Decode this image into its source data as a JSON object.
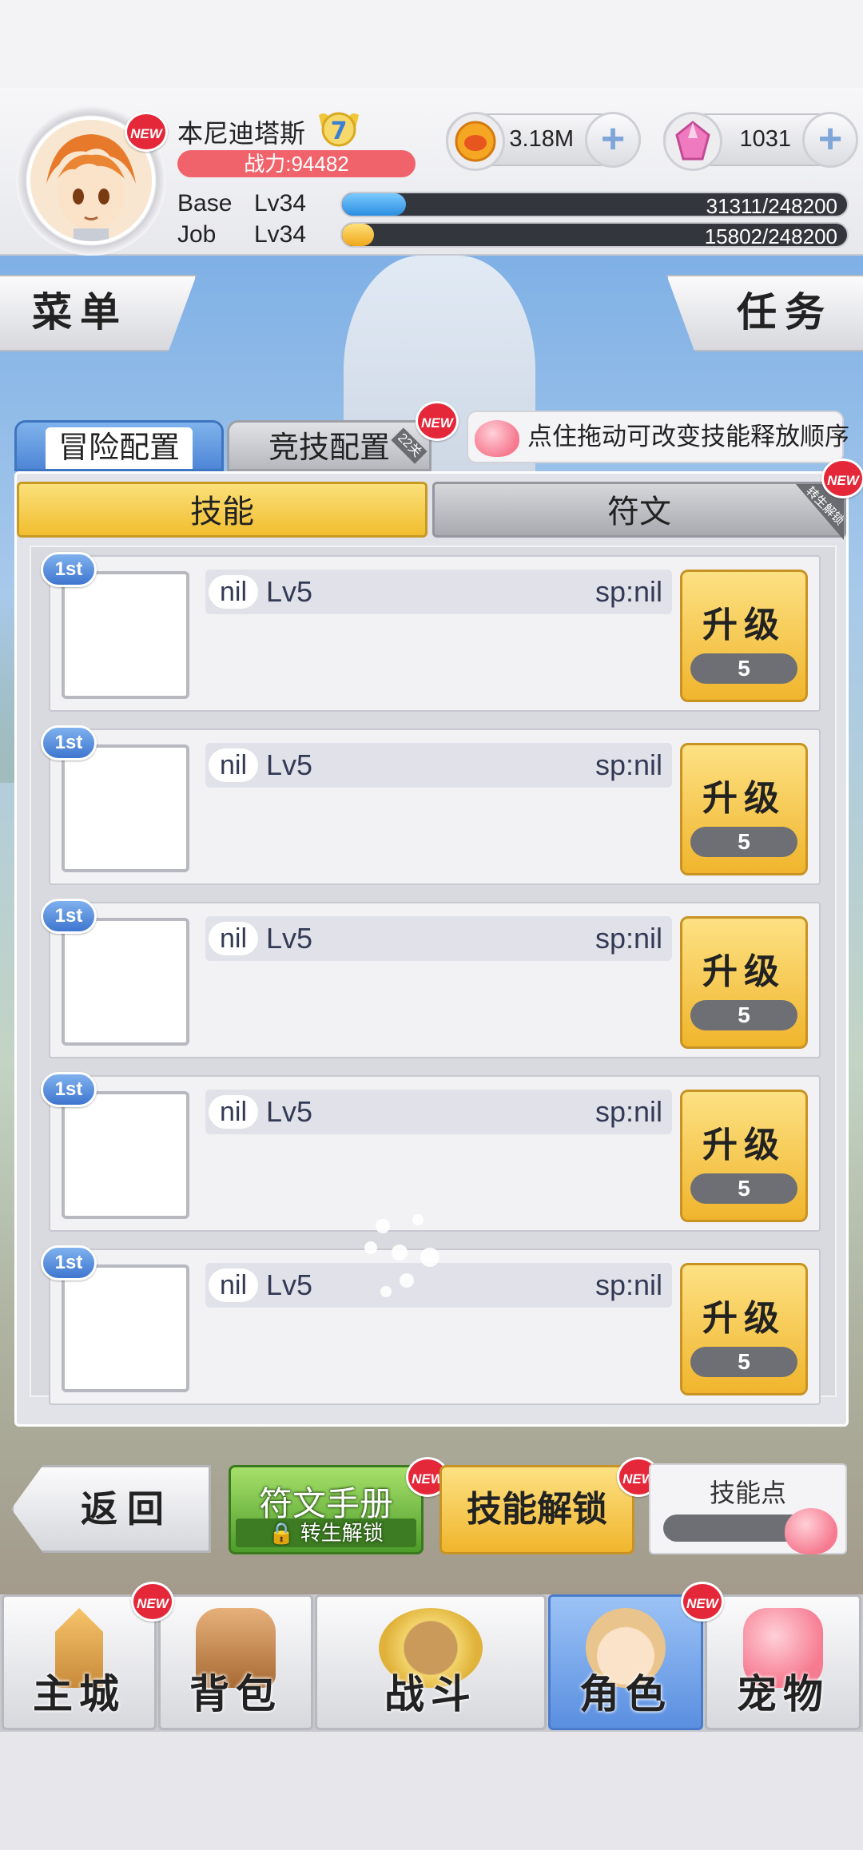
{
  "header": {
    "player_name": "本尼迪塔斯",
    "rank": "7",
    "power": "战力:94482",
    "zeny": "3.18M",
    "gems": "1031",
    "base_label": "Base",
    "base_level": "Lv34",
    "base_exp": "31311/248200",
    "base_progress": 0.126,
    "job_label": "Job",
    "job_level": "Lv34",
    "job_exp": "15802/248200",
    "job_progress": 0.064,
    "new": "NEW"
  },
  "corner": {
    "menu": "菜单",
    "task": "任务"
  },
  "tabs": {
    "adventure": "冒险配置",
    "arena": "竞技配置",
    "arena_tag": "22关",
    "tip": "点住拖动可改变技能释放顺序"
  },
  "subtabs": {
    "skill": "技能",
    "rune": "符文",
    "rune_tag": "转生解锁"
  },
  "skills": [
    {
      "badge": "1st",
      "name": "nil",
      "level": "Lv5",
      "sp": "sp:nil",
      "button": "升级",
      "cost": "5"
    },
    {
      "badge": "1st",
      "name": "nil",
      "level": "Lv5",
      "sp": "sp:nil",
      "button": "升级",
      "cost": "5"
    },
    {
      "badge": "1st",
      "name": "nil",
      "level": "Lv5",
      "sp": "sp:nil",
      "button": "升级",
      "cost": "5"
    },
    {
      "badge": "1st",
      "name": "nil",
      "level": "Lv5",
      "sp": "sp:nil",
      "button": "升级",
      "cost": "5"
    },
    {
      "badge": "1st",
      "name": "nil",
      "level": "Lv5",
      "sp": "sp:nil",
      "button": "升级",
      "cost": "5"
    }
  ],
  "actions": {
    "back": "返回",
    "rune_book": "符文手册",
    "rune_book_lock": "转生解锁",
    "skill_unlock": "技能解锁",
    "skill_points": "技能点"
  },
  "nav": [
    {
      "label": "主城",
      "icon": "castle-icon"
    },
    {
      "label": "背包",
      "icon": "backpack-icon"
    },
    {
      "label": "战斗",
      "icon": "battle-shield-icon"
    },
    {
      "label": "角色",
      "icon": "character-icon"
    },
    {
      "label": "宠物",
      "icon": "pet-icon"
    }
  ],
  "colors": {
    "accent_blue": "#4e86d6",
    "gold": "#f0b52c",
    "green": "#4d9c2a",
    "red_badge": "#e4283a"
  }
}
